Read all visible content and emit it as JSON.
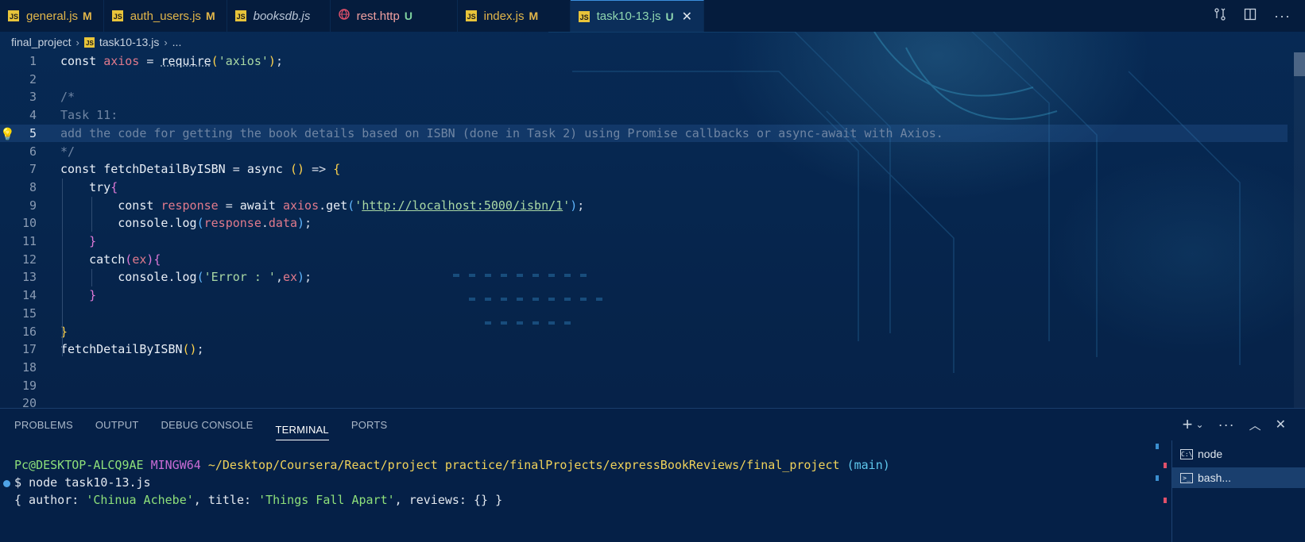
{
  "tabs": [
    {
      "name": "general.js",
      "badge": "M",
      "type": "js"
    },
    {
      "name": "auth_users.js",
      "badge": "M",
      "type": "js"
    },
    {
      "name": "booksdb.js",
      "badge": "",
      "type": "js",
      "italic": true
    },
    {
      "name": "rest.http",
      "badge": "U",
      "type": "http"
    },
    {
      "name": "index.js",
      "badge": "M",
      "type": "js"
    },
    {
      "name": "task10-13.js",
      "badge": "U",
      "type": "js",
      "active": true
    }
  ],
  "tab_actions": [
    "compare-changes-icon",
    "split-editor-icon",
    "more-actions-icon"
  ],
  "colors": {
    "accent": "#3c8fdc",
    "js_icon": "#e8c43a",
    "modified": "#e2b64a",
    "untracked": "#7fd3a0"
  },
  "breadcrumb": {
    "folder": "final_project",
    "file": "task10-13.js",
    "more": "..."
  },
  "editor": {
    "current_line": 5,
    "line_numbers": [
      "1",
      "2",
      "3",
      "4",
      "5",
      "6",
      "7",
      "8",
      "9",
      "10",
      "11",
      "12",
      "13",
      "14",
      "15",
      "16",
      "17",
      "18",
      "19",
      "20"
    ]
  },
  "panel": {
    "tabs": [
      "PROBLEMS",
      "OUTPUT",
      "DEBUG CONSOLE",
      "TERMINAL",
      "PORTS"
    ],
    "active_tab": "TERMINAL"
  },
  "terminal": {
    "user": "Pc@DESKTOP-ALCQ9AE",
    "host": "MINGW64",
    "path": "~/Desktop/Coursera/React/project practice/finalProjects/expressBookReviews/final_project",
    "branch": "(main)",
    "prompt": "$",
    "command": "node task10-13.js",
    "output_prefix": "{ author: ",
    "author_value": "'Chinua Achebe'",
    "output_mid": ", title: ",
    "title_value": "'Things Fall Apart'",
    "output_suffix": ", reviews: {} }"
  },
  "terminal_list": [
    {
      "label": "node",
      "active": false
    },
    {
      "label": "bash...",
      "active": true
    }
  ]
}
